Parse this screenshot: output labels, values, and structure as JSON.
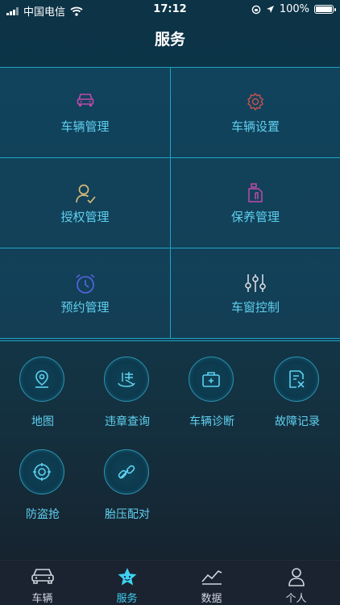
{
  "status_bar": {
    "carrier": "中国电信",
    "time": "17:12",
    "battery": "100%"
  },
  "page_title": "服务",
  "grid": [
    {
      "label": "车辆管理",
      "icon": "car-icon",
      "color": "#c04aa8"
    },
    {
      "label": "车辆设置",
      "icon": "gear-icon",
      "color": "#c0504f"
    },
    {
      "label": "授权管理",
      "icon": "user-check-icon",
      "color": "#d8b878"
    },
    {
      "label": "保养管理",
      "icon": "oil-can-icon",
      "color": "#c04aa8"
    },
    {
      "label": "预约管理",
      "icon": "alarm-clock-icon",
      "color": "#4f62d8"
    },
    {
      "label": "车窗控制",
      "icon": "sliders-icon",
      "color": "#d8d8e0"
    }
  ],
  "services": [
    {
      "label": "地图",
      "icon": "map-pin-icon"
    },
    {
      "label": "违章查询",
      "icon": "violation-icon"
    },
    {
      "label": "车辆诊断",
      "icon": "medkit-icon"
    },
    {
      "label": "故障记录",
      "icon": "fault-record-icon"
    },
    {
      "label": "防盗抢",
      "icon": "anti-theft-icon"
    },
    {
      "label": "胎压配对",
      "icon": "link-icon"
    }
  ],
  "tabs": [
    {
      "label": "车辆",
      "icon": "car-icon"
    },
    {
      "label": "服务",
      "icon": "star-icon",
      "active": true
    },
    {
      "label": "数据",
      "icon": "chart-line-icon"
    },
    {
      "label": "个人",
      "icon": "person-icon"
    }
  ]
}
